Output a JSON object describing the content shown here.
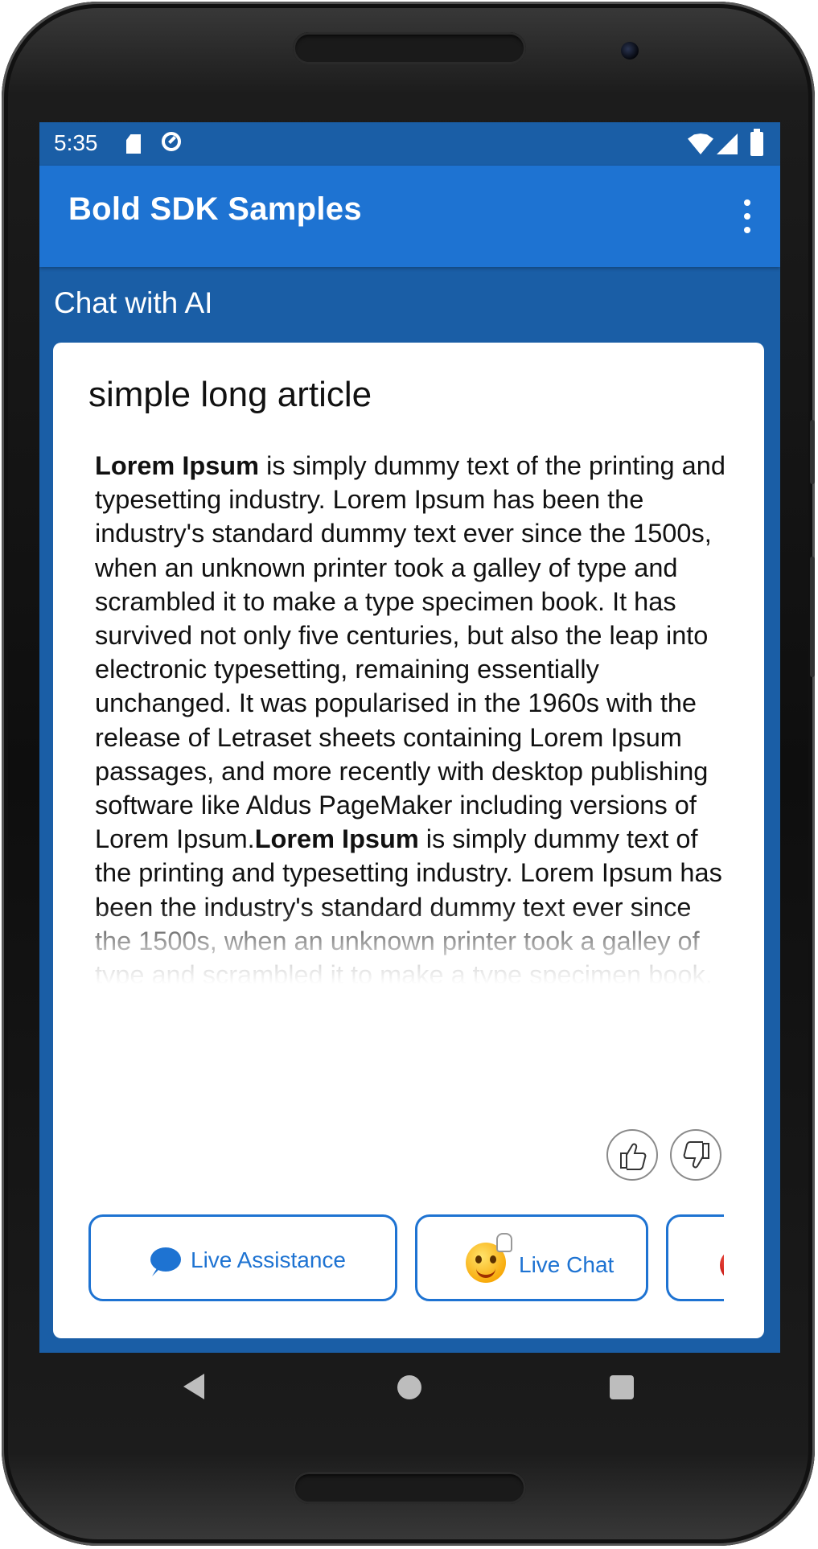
{
  "status_bar": {
    "time": "5:35",
    "icons": [
      "sd-card-icon",
      "sync-icon",
      "wifi-icon",
      "signal-icon",
      "battery-icon"
    ]
  },
  "app_bar": {
    "title": "Bold SDK Samples",
    "menu_icon": "more-vert-icon"
  },
  "section": {
    "title": "Chat with AI"
  },
  "article": {
    "title": "simple long article",
    "bold_1": "Lorem Ipsum",
    "text_1": " is simply dummy text of the printing and typesetting industry. Lorem Ipsum has been the industry's standard dummy text ever since the 1500s, when an unknown printer took a galley of type and scrambled it to make a type specimen book. It has survived not only five centuries, but also the leap into electronic typesetting, remaining essentially unchanged. It was popularised in the 1960s with the release of Letraset sheets containing Lorem Ipsum passages, and more recently with desktop publishing software like Aldus PageMaker including versions of Lorem Ipsum.",
    "bold_2": "Lorem Ipsum",
    "text_2": " is simply dummy text of the printing and typesetting industry. Lorem Ipsum has been the industry's standard dummy text ever since the 1500s, when an unknown printer took a galley of type and scrambled it to make a type specimen book. It has survived not only five centuries, but"
  },
  "feedback": {
    "thumbs_up_icon": "thumbs-up-icon",
    "thumbs_down_icon": "thumbs-down-icon"
  },
  "actions": [
    {
      "label": "Live Assistance",
      "icon": "chat-bubble-icon"
    },
    {
      "label": "Live Chat",
      "icon": "smiley-wave-icon"
    },
    {
      "label": "",
      "icon": "devil-icon"
    }
  ],
  "colors": {
    "primary": "#1e73d2",
    "primary_dark": "#1a5ea6",
    "card_bg": "#ffffff",
    "text": "#111111"
  },
  "nav_bar": {
    "icons": [
      "back-icon",
      "home-icon",
      "recents-icon"
    ]
  }
}
